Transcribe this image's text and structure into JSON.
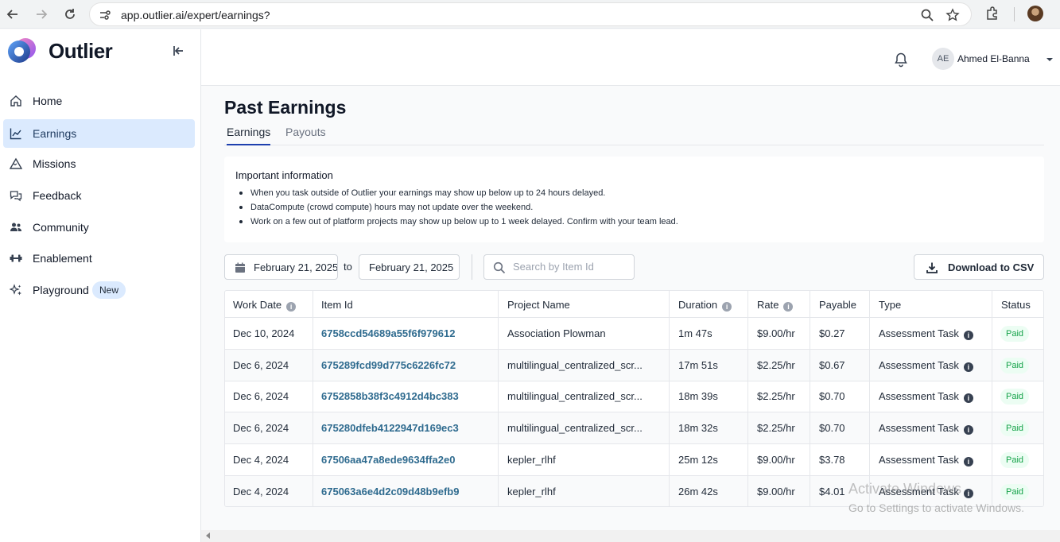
{
  "browser": {
    "url": "app.outlier.ai/expert/earnings?"
  },
  "sidebar": {
    "logo_text": "Outlier",
    "items": [
      {
        "label": "Home",
        "icon": "home-icon"
      },
      {
        "label": "Earnings",
        "icon": "chart-line-icon",
        "active": true
      },
      {
        "label": "Missions",
        "icon": "mountain-icon"
      },
      {
        "label": "Feedback",
        "icon": "chat-bubbles-icon"
      },
      {
        "label": "Community",
        "icon": "users-icon"
      },
      {
        "label": "Enablement",
        "icon": "dumbbell-icon"
      },
      {
        "label": "Playground",
        "icon": "sparkles-icon",
        "badge": "New"
      }
    ]
  },
  "header": {
    "user_initials": "AE",
    "user_name": "Ahmed El-Banna"
  },
  "page": {
    "title": "Past Earnings",
    "tabs": [
      {
        "label": "Earnings",
        "active": true
      },
      {
        "label": "Payouts",
        "active": false
      }
    ]
  },
  "info": {
    "title": "Important information",
    "items": [
      "When you task outside of Outlier your earnings may show up below up to 24 hours delayed.",
      "DataCompute (crowd compute) hours may not update over the weekend.",
      "Work on a few out of platform projects may show up below up to 1 week delayed. Confirm with your team lead."
    ]
  },
  "filters": {
    "date_from": "February 21, 2025",
    "to_label": "to",
    "date_to": "February 21, 2025",
    "search_placeholder": "Search by Item Id",
    "download_label": "Download to CSV"
  },
  "table": {
    "columns": [
      "Work Date",
      "Item Id",
      "Project Name",
      "Duration",
      "Rate",
      "Payable",
      "Type",
      "Status"
    ],
    "rows": [
      {
        "date": "Dec 10, 2024",
        "item_id": "6758ccd54689a55f6f979612",
        "project": "Association Plowman",
        "duration": "1m 47s",
        "rate": "$9.00/hr",
        "payable": "$0.27",
        "type": "Assessment Task",
        "status": "Paid"
      },
      {
        "date": "Dec 6, 2024",
        "item_id": "675289fcd99d775c6226fc72",
        "project": "multilingual_centralized_scr...",
        "duration": "17m 51s",
        "rate": "$2.25/hr",
        "payable": "$0.67",
        "type": "Assessment Task",
        "status": "Paid"
      },
      {
        "date": "Dec 6, 2024",
        "item_id": "6752858b38f3c4912d4bc383",
        "project": "multilingual_centralized_scr...",
        "duration": "18m 39s",
        "rate": "$2.25/hr",
        "payable": "$0.70",
        "type": "Assessment Task",
        "status": "Paid"
      },
      {
        "date": "Dec 6, 2024",
        "item_id": "675280dfeb4122947d169ec3",
        "project": "multilingual_centralized_scr...",
        "duration": "18m 32s",
        "rate": "$2.25/hr",
        "payable": "$0.70",
        "type": "Assessment Task",
        "status": "Paid"
      },
      {
        "date": "Dec 4, 2024",
        "item_id": "67506aa47a8ede9634ffa2e0",
        "project": "kepler_rlhf",
        "duration": "25m 12s",
        "rate": "$9.00/hr",
        "payable": "$3.78",
        "type": "Assessment Task",
        "status": "Paid"
      },
      {
        "date": "Dec 4, 2024",
        "item_id": "675063a6e4d2c09d48b9efb9",
        "project": "kepler_rlhf",
        "duration": "26m 42s",
        "rate": "$9.00/hr",
        "payable": "$4.01",
        "type": "Assessment Task",
        "status": "Paid"
      }
    ]
  },
  "watermark": {
    "line1": "Activate Windows",
    "line2": "Go to Settings to activate Windows."
  }
}
